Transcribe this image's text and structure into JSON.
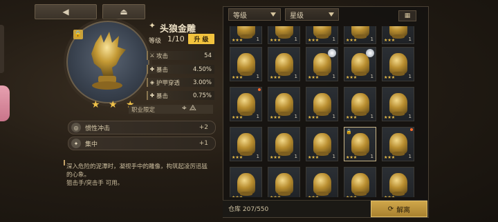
{
  "nav": {
    "back_icon": "back-arrow-icon",
    "home_icon": "home-icon"
  },
  "item": {
    "name": "头狼金雕",
    "level_label": "等级",
    "level_value": "1/10",
    "upgrade_label": "升 级",
    "stars": "★ ★ ★",
    "stats": [
      {
        "icon": "sword-icon",
        "name": "攻击",
        "value": "54"
      },
      {
        "icon": "crit-icon",
        "name": "暴击",
        "value": "4.50%"
      },
      {
        "icon": "armor-pierce-icon",
        "name": "护甲穿透",
        "value": "3.00%"
      },
      {
        "icon": "crit-icon",
        "name": "暴击",
        "value": "0.75%"
      }
    ],
    "restriction_label": "职业限定",
    "skills": [
      {
        "icon": "inertia-icon",
        "name": "惯性冲击",
        "value": "+2"
      },
      {
        "icon": "focus-icon",
        "name": "集中",
        "value": "+1"
      }
    ],
    "description_lines": [
      "深入危险的泥潭时，凝视手中的雕像，构筑起凌厉迅猛",
      "的心象。",
      "狙击手/突击手 可用。"
    ]
  },
  "inventory": {
    "filter_level": "等级",
    "filter_star": "星级",
    "cells": [
      {
        "stars": "★★★",
        "count": "1",
        "orb": false,
        "dot": false,
        "lock": false,
        "sel": false
      },
      {
        "stars": "★★★",
        "count": "1",
        "orb": false,
        "dot": false,
        "lock": false,
        "sel": false
      },
      {
        "stars": "★★★",
        "count": "1",
        "orb": false,
        "dot": false,
        "lock": false,
        "sel": false
      },
      {
        "stars": "★★★",
        "count": "1",
        "orb": false,
        "dot": false,
        "lock": false,
        "sel": false
      },
      {
        "stars": "★★★",
        "count": "1",
        "orb": false,
        "dot": false,
        "lock": false,
        "sel": false
      },
      {
        "stars": "★★★",
        "count": "1",
        "orb": false,
        "dot": false,
        "lock": false,
        "sel": false
      },
      {
        "stars": "★★★",
        "count": "1",
        "orb": false,
        "dot": false,
        "lock": false,
        "sel": false
      },
      {
        "stars": "★★★",
        "count": "1",
        "orb": true,
        "dot": false,
        "lock": false,
        "sel": false
      },
      {
        "stars": "★★★",
        "count": "1",
        "orb": true,
        "dot": false,
        "lock": false,
        "sel": false
      },
      {
        "stars": "★★★",
        "count": "1",
        "orb": false,
        "dot": false,
        "lock": false,
        "sel": false
      },
      {
        "stars": "★★★",
        "count": "1",
        "orb": false,
        "dot": true,
        "lock": false,
        "sel": false
      },
      {
        "stars": "★★★",
        "count": "1",
        "orb": false,
        "dot": false,
        "lock": false,
        "sel": false
      },
      {
        "stars": "★★★",
        "count": "1",
        "orb": false,
        "dot": false,
        "lock": false,
        "sel": false
      },
      {
        "stars": "★★★",
        "count": "1",
        "orb": false,
        "dot": false,
        "lock": false,
        "sel": false
      },
      {
        "stars": "★★★",
        "count": "1",
        "orb": false,
        "dot": false,
        "lock": false,
        "sel": false
      },
      {
        "stars": "★★★",
        "count": "1",
        "orb": false,
        "dot": false,
        "lock": false,
        "sel": false
      },
      {
        "stars": "★★★",
        "count": "1",
        "orb": false,
        "dot": false,
        "lock": false,
        "sel": false
      },
      {
        "stars": "★★★",
        "count": "1",
        "orb": false,
        "dot": false,
        "lock": false,
        "sel": false
      },
      {
        "stars": "★★★",
        "count": "1",
        "orb": false,
        "dot": false,
        "lock": true,
        "sel": true
      },
      {
        "stars": "★★★",
        "count": "1",
        "orb": false,
        "dot": true,
        "lock": false,
        "sel": false
      },
      {
        "stars": "★★★",
        "count": "",
        "orb": false,
        "dot": false,
        "lock": false,
        "sel": false
      },
      {
        "stars": "★★★",
        "count": "",
        "orb": false,
        "dot": false,
        "lock": false,
        "sel": false
      },
      {
        "stars": "★★★",
        "count": "",
        "orb": false,
        "dot": false,
        "lock": false,
        "sel": false
      },
      {
        "stars": "★★★",
        "count": "",
        "orb": false,
        "dot": false,
        "lock": false,
        "sel": false
      },
      {
        "stars": "★★★",
        "count": "",
        "orb": false,
        "dot": false,
        "lock": false,
        "sel": false
      }
    ],
    "storage_label": "仓库 207/550",
    "decompose_label": "解离"
  }
}
